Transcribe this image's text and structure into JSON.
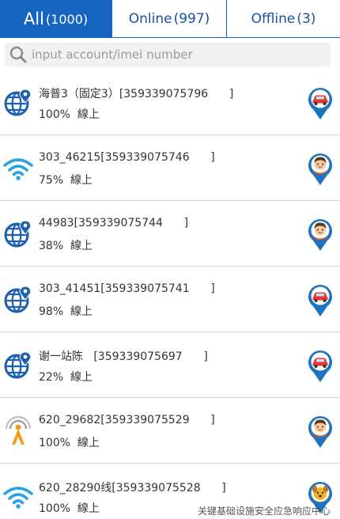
{
  "tabs": [
    {
      "name": "All",
      "count": "(1000)"
    },
    {
      "name": "Online",
      "count": "(997)"
    },
    {
      "name": "Offline",
      "count": "(3)"
    }
  ],
  "search": {
    "placeholder": "input account/imei number"
  },
  "devices": [
    {
      "title": "海普3（固定3）[359339075796      ]",
      "status": "100%  線上",
      "type_icon": "globe-pin-icon",
      "avatar": "car-icon"
    },
    {
      "title": "303_46215[359339075746      ]",
      "status": "75%  線上",
      "type_icon": "wifi-icon",
      "avatar": "person-icon"
    },
    {
      "title": "44983[359339075744      ]",
      "status": "38%  線上",
      "type_icon": "globe-pin-icon",
      "avatar": "person-icon"
    },
    {
      "title": "303_41451[359339075741      ]",
      "status": "98%  線上",
      "type_icon": "globe-pin-icon",
      "avatar": "car-icon"
    },
    {
      "title": "谢一站陈   [359339075697      ]",
      "status": "22%  線上",
      "type_icon": "globe-pin-icon",
      "avatar": "car-icon"
    },
    {
      "title": "620_29682[359339075529      ]",
      "status": "100%  線上",
      "type_icon": "antenna-icon",
      "avatar": "person-icon"
    },
    {
      "title": "620_28290线[359339075528      ]",
      "status": "100%  線上",
      "type_icon": "wifi-icon",
      "avatar": "dog-icon"
    }
  ],
  "watermark": "关键基础设施安全应急响应中心",
  "colors": {
    "brand": "#1565c0",
    "car": "#e53935",
    "pin": "#1e73be"
  }
}
